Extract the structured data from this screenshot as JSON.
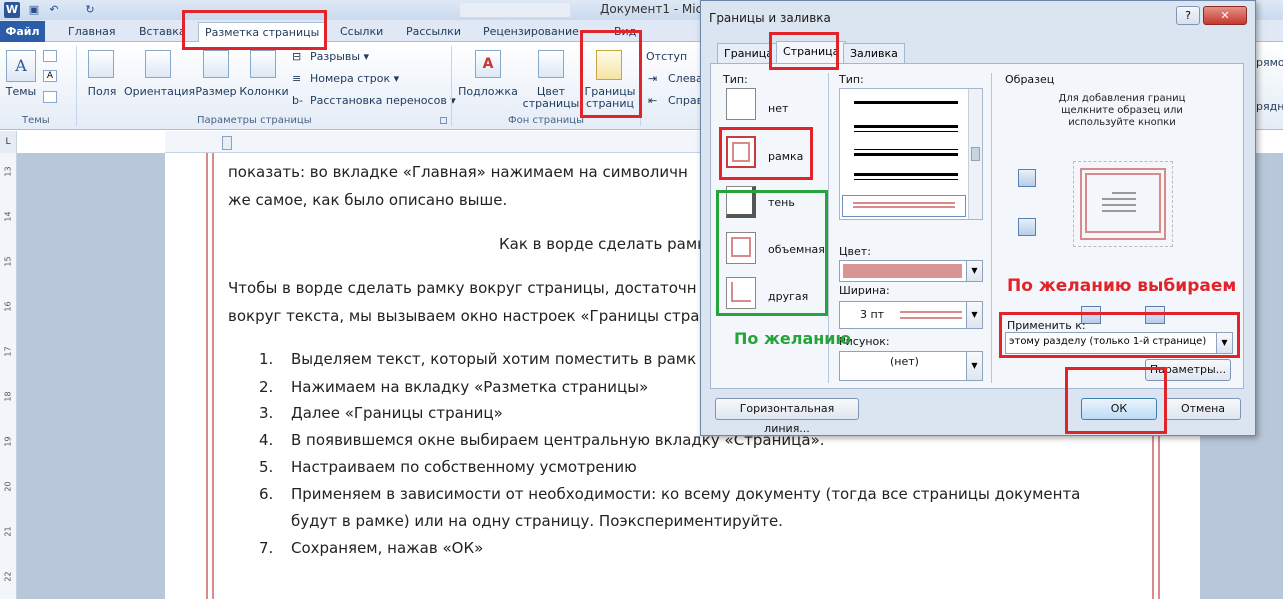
{
  "window": {
    "doc_title": "Документ1 - Micr",
    "app_icon": "W"
  },
  "ribbon": {
    "file_tab": "Файл",
    "tabs": [
      "Главная",
      "Вставка",
      "Разметка страницы",
      "Ссылки",
      "Рассылки",
      "Рецензирование",
      "Вид"
    ],
    "themes": {
      "btn": "Темы",
      "group": "Темы"
    },
    "page_setup": {
      "fields": "Поля",
      "orientation": "Ориентация",
      "size": "Размер",
      "columns": "Колонки",
      "breaks": "Разрывы",
      "line_numbers": "Номера строк",
      "hyphenation": "Расстановка переносов",
      "group": "Параметры страницы"
    },
    "page_bg": {
      "watermark": "Подложка",
      "page_color": "Цвет страницы",
      "page_borders": "Границы страниц",
      "group": "Фон страницы"
    },
    "paragraph": {
      "indent": "Отступ",
      "left": "Слева",
      "right": "Справ"
    },
    "cut_right": [
      "рямо",
      "рядн"
    ]
  },
  "document": {
    "lines": [
      "показать: во вкладке «Главная» нажимаем на символичн",
      "же самое, как было описано выше.",
      "Как в ворде сделать рамк",
      "Чтобы в ворде сделать рамку вокруг страницы, достаточн",
      "вокруг текста, мы вызываем окно настроек «Границы стра"
    ],
    "list": [
      {
        "num": "1.",
        "text": "Выделяем текст, который хотим поместить в рамк"
      },
      {
        "num": "2.",
        "text": "Нажимаем на вкладку «Разметка страницы»"
      },
      {
        "num": "3.",
        "text": "Далее «Границы страниц»"
      },
      {
        "num": "4.",
        "text": "В появившемся окне выбираем центральную вкладку «Страница»."
      },
      {
        "num": "5.",
        "text": "Настраиваем по собственному усмотрению"
      },
      {
        "num": "6.",
        "text": "Применяем в зависимости от необходимости: ко всему документу (тогда все страницы документа"
      },
      {
        "num": "",
        "text": "будут в рамке) или на одну страницу. Поэкспериментируйте."
      },
      {
        "num": "7.",
        "text": "Сохраняем, нажав «ОК»"
      }
    ],
    "ruler_numbers": [
      "13",
      "14",
      "15",
      "16",
      "17",
      "18",
      "19",
      "20",
      "21",
      "22"
    ]
  },
  "dialog": {
    "title": "Границы и заливка",
    "help": "?",
    "close": "✕",
    "tabs": [
      "Граница",
      "Страница",
      "Заливка"
    ],
    "type_label": "Тип:",
    "types": [
      "нет",
      "рамка",
      "тень",
      "объемная",
      "другая"
    ],
    "style_label": "Тип:",
    "color_label": "Цвет:",
    "width_label": "Ширина:",
    "width_value": "3 пт",
    "art_label": "Рисунок:",
    "art_value": "(нет)",
    "preview_label": "Образец",
    "preview_hint": "Для добавления границ щелкните образец или используйте кнопки",
    "apply_label": "Применить к:",
    "apply_value": "этому разделу (только 1-й странице)",
    "options_btn": "Параметры...",
    "hline_btn": "Горизонтальная линия...",
    "ok_btn": "ОК",
    "cancel_btn": "Отмена"
  },
  "annotations": {
    "optional_green": "По желанию",
    "optional_red": "По желанию выбираем"
  },
  "colors": {
    "annotation_red": "#e0242a",
    "annotation_green": "#26a43b",
    "border_pink": "#d98a8a"
  }
}
